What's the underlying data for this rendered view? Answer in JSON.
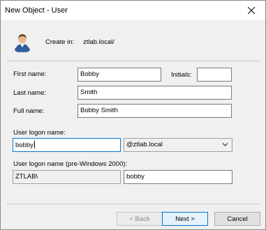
{
  "window": {
    "title": "New Object - User"
  },
  "create_in": {
    "label": "Create in:",
    "path": "ztlab.local/"
  },
  "form": {
    "first_name": {
      "label": "First name:",
      "value": "Bobby"
    },
    "initials": {
      "label": "Initials:",
      "value": ""
    },
    "last_name": {
      "label": "Last name:",
      "value": "Smith"
    },
    "full_name": {
      "label": "Full name:",
      "value": "Bobby Smith"
    },
    "logon_name": {
      "label": "User logon name:",
      "value": "bobby"
    },
    "upn_suffix": {
      "value": "@ztlab.local"
    },
    "pre2000": {
      "label": "User logon name (pre-Windows 2000):",
      "domain": "ZTLAB\\",
      "value": "bobby"
    }
  },
  "buttons": {
    "back": "< Back",
    "next": "Next >",
    "cancel": "Cancel"
  },
  "icons": {
    "user": "user-icon",
    "close": "close-icon",
    "dropdown": "chevron-down-icon"
  },
  "colors": {
    "accent": "#0078d7",
    "window_bg": "#f0f0f0",
    "titlebar_bg": "#ffffff"
  }
}
